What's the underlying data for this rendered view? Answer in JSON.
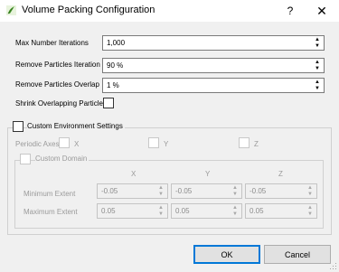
{
  "window": {
    "title": "Volume Packing Configuration",
    "help_glyph": "?",
    "close_glyph": "✕"
  },
  "fields": {
    "max_iterations": {
      "label": "Max Number Iterations",
      "value": "1,000"
    },
    "remove_iteration": {
      "label": "Remove Particles Iteration",
      "value": "90 %"
    },
    "remove_overlap": {
      "label": "Remove Particles Overlap",
      "value": "1 %"
    },
    "shrink_overlap": {
      "label": "Shrink Overlapping Particles",
      "checked": false
    }
  },
  "custom_env": {
    "label": "Custom Environment Settings",
    "checked": false,
    "periodic_axes": {
      "label": "Periodic Axes",
      "x": "X",
      "y": "Y",
      "z": "Z"
    },
    "custom_domain": {
      "label": "Custom Domain",
      "checked": false,
      "headers": {
        "x": "X",
        "y": "Y",
        "z": "Z"
      },
      "min_extent": {
        "label": "Minimum Extent",
        "x": "-0.05",
        "y": "-0.05",
        "z": "-0.05"
      },
      "max_extent": {
        "label": "Maximum Extent",
        "x": "0.05",
        "y": "0.05",
        "z": "0.05"
      }
    }
  },
  "buttons": {
    "ok": "OK",
    "cancel": "Cancel"
  },
  "glyphs": {
    "up": "▲",
    "down": "▼"
  },
  "icons": {
    "app": "app-icon",
    "help": "help-icon",
    "close": "close-icon",
    "resize": "resize-grip-icon"
  },
  "colors": {
    "accent": "#0078d7"
  }
}
